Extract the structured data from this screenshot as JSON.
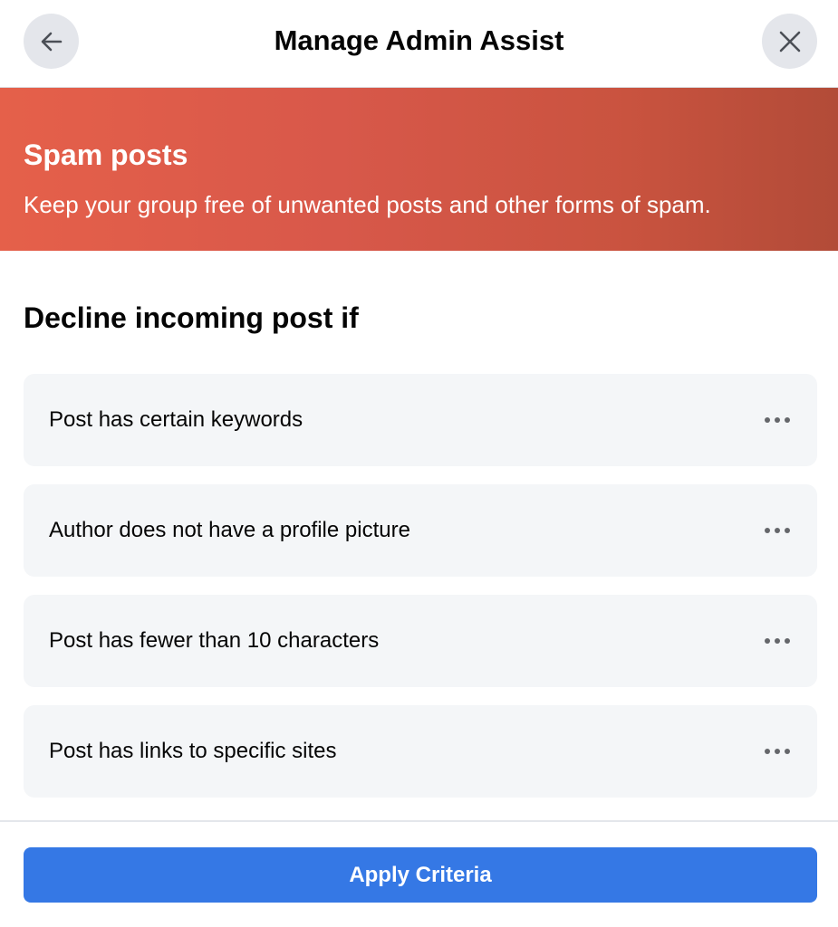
{
  "header": {
    "title": "Manage Admin Assist",
    "back_icon": "arrow-left-icon",
    "close_icon": "close-icon"
  },
  "banner": {
    "title": "Spam posts",
    "description": "Keep your group free of unwanted posts and other forms of spam.",
    "colors": [
      "#e5604a",
      "#b24b38"
    ]
  },
  "section": {
    "title": "Decline incoming post if"
  },
  "criteria": [
    {
      "label": "Post has certain keywords",
      "icon": "more-horizontal-icon"
    },
    {
      "label": "Author does not have a profile picture",
      "icon": "more-horizontal-icon"
    },
    {
      "label": "Post has fewer than 10 characters",
      "icon": "more-horizontal-icon"
    },
    {
      "label": "Post has links to specific sites",
      "icon": "more-horizontal-icon"
    }
  ],
  "footer": {
    "apply_label": "Apply Criteria",
    "accent_color": "#3578e5"
  }
}
